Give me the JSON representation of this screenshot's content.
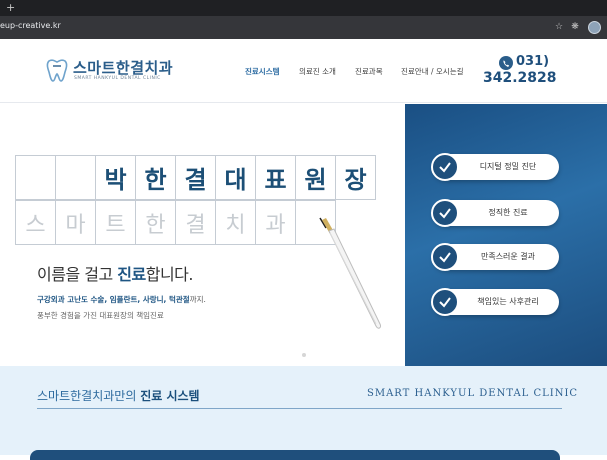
{
  "browser": {
    "tab_plus": "+",
    "url": "eup-creative.kr",
    "icons": [
      "star-icon",
      "extension-icon",
      "puzzle-icon",
      "profile-avatar"
    ]
  },
  "header": {
    "logo_name": "스마트한결치과",
    "logo_sub": "SMART HANKYUL DENTAL CLINIC",
    "nav": [
      "진료시스템",
      "의료진 소개",
      "진료과목",
      "진료안내 / 오시는길"
    ],
    "active_nav": "진료시스템",
    "phone_area": "031)",
    "phone_number": "342.2828"
  },
  "hero": {
    "title_chars": [
      "박",
      "한",
      "결",
      "대",
      "표",
      "원",
      "장"
    ],
    "clinic_chars": [
      "스",
      "마",
      "트",
      "한",
      "결",
      "치",
      "과"
    ],
    "headline_pre": "이름을 걸고 ",
    "headline_bold": "진료",
    "headline_post": "합니다.",
    "sub1_bold": "구강외과 고난도 수술, 임플란트, 사랑니, 턱관절",
    "sub1_post": "까지.",
    "sub2": "풍부한 경험을 가진 대표원장의 책임진료",
    "features": [
      "디지털 정밀 진단",
      "정직한 진료",
      "만족스러운 결과",
      "책임있는 사후관리"
    ]
  },
  "section": {
    "title_pre": "스마트한결치과만의 ",
    "title_bold": "진료 시스템",
    "title_en": "SMART HANKYUL DENTAL CLINIC"
  },
  "colors": {
    "brand": "#2a5d8a",
    "accent": "#2a6aa1",
    "panel": "#1f5a91",
    "section_bg": "#e5f1fa"
  }
}
